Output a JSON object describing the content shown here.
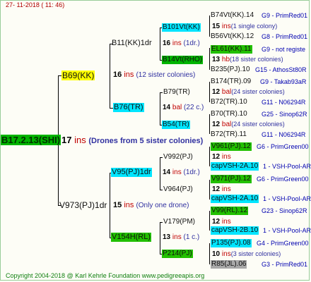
{
  "header": {
    "date": "27- 11-2018 ( 11: 46)"
  },
  "footer": {
    "copyright": "Copyright 2004-2018 @ Karl Kehrle Foundation   www.pedigreeapis.org"
  },
  "root": {
    "name": "B17.2.13(SHI)",
    "num": "17",
    "ins": "ins",
    "note": "(Drones from 5 sister colonies)"
  },
  "gen1": {
    "upper": {
      "name": "B69(KK)",
      "num": "16",
      "ins": "ins",
      "note": "(12 sister colonies)"
    },
    "lower": {
      "name": "V973(PJ)1dr",
      "num": "15",
      "ins": "ins",
      "note": "(Only one drone)"
    }
  },
  "gen2": {
    "b11": {
      "name": "B11(KK)1dr",
      "num": "16",
      "ins": "ins",
      "note": "(1dr.)"
    },
    "b76": {
      "name": "B76(TR)",
      "num": "14",
      "ins": "bal",
      "note": "(22 c.)"
    },
    "v95": {
      "name": "V95(PJ)1dr",
      "num": "14",
      "ins": "ins",
      "note": "(1dr.)"
    },
    "v154": {
      "name": "V154H(RL)",
      "num": "13",
      "ins": "ins",
      "note": "(1 c.)"
    }
  },
  "gen3": {
    "b101": {
      "name": "B101Vt(KK)",
      "num": "15",
      "ins": "ins",
      "note": "(1 single colony)"
    },
    "b14": {
      "name": "B14Vt(RHO)",
      "num": "13",
      "ins": "hb",
      "note": "(18 sister colonies)"
    },
    "b79": {
      "name": "B79(TR)",
      "num": "12",
      "ins": "bal",
      "note": "(24 sister colonies)"
    },
    "b54": {
      "name": "B54(TR)",
      "num": "12",
      "ins": "bal",
      "note": "(24 sister colonies)"
    },
    "v992": {
      "name": "V992(PJ)",
      "num": "12",
      "ins": "ins",
      "note": ""
    },
    "v964": {
      "name": "V964(PJ)",
      "num": "12",
      "ins": "ins",
      "note": ""
    },
    "v179": {
      "name": "V179(PM)",
      "num": "12",
      "ins": "ins",
      "note": ""
    },
    "p214": {
      "name": "P214(PJ)",
      "num": "10",
      "ins": "ins",
      "note": "(3 sister colonies)"
    }
  },
  "gen4": [
    {
      "name": "B74Vt(KK).14",
      "info": "G9 - PrimRed01"
    },
    {
      "name": "B56Vt(KK).12",
      "info": "G8 - PrimRed01"
    },
    {
      "name": "EL61(KK).11",
      "info": "G9 - not registe"
    },
    {
      "name": "B235(PJ).10",
      "info": "G15 - AthosSt80R"
    },
    {
      "name": "B174(TR).09",
      "info": "G9 - Takab93aR"
    },
    {
      "name": "B72(TR).10",
      "info": "G11 - N06294R"
    },
    {
      "name": "B70(TR).10",
      "info": "G25 - Sinop62R"
    },
    {
      "name": "B72(TR).11",
      "info": "G11 - N06294R"
    },
    {
      "name": "V961(PJ).12",
      "info": "G6 - PrimGreen00"
    },
    {
      "name": "capVSH-2A.10",
      "info": "1 - VSH-Pool-AR"
    },
    {
      "name": "V971(PJ).12",
      "info": "G6 - PrimGreen00"
    },
    {
      "name": "capVSH-2A.10",
      "info": "1 - VSH-Pool-AR"
    },
    {
      "name": "V99(RL).12",
      "info": "G23 - Sinop62R"
    },
    {
      "name": "capVSH-2B.10",
      "info": "1 - VSH-Pool-AR"
    },
    {
      "name": "P135(PJ).08",
      "info": "G4 - PrimGreen00"
    },
    {
      "name": "R85(JL).06",
      "info": "G3 - PrimRed01"
    }
  ]
}
